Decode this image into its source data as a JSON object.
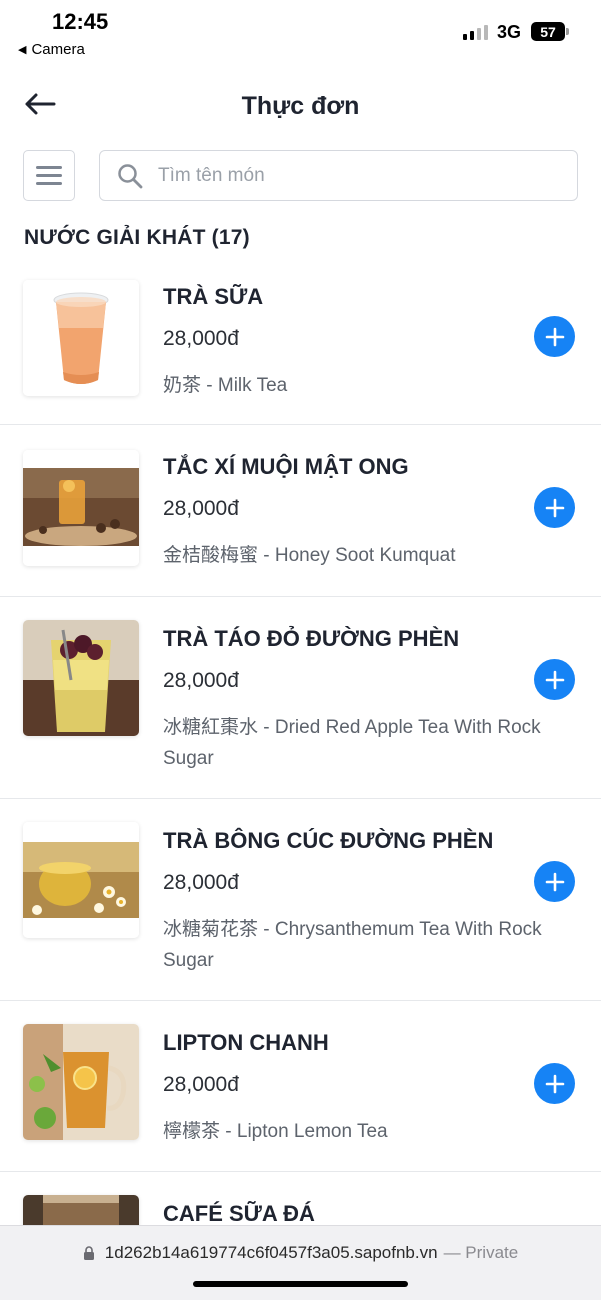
{
  "status_bar": {
    "time": "12:45",
    "back_app": "Camera",
    "network": "3G",
    "battery": "57"
  },
  "header": {
    "title": "Thực đơn"
  },
  "search": {
    "placeholder": "Tìm tên món"
  },
  "category": {
    "label": "NƯỚC GIẢI KHÁT (17)"
  },
  "items": [
    {
      "name": "TRÀ SỮA",
      "price": "28,000đ",
      "desc": "奶茶 - Milk Tea"
    },
    {
      "name": "TẮC XÍ MUỘI MẬT ONG",
      "price": "28,000đ",
      "desc": "金桔酸梅蜜 - Honey Soot Kumquat"
    },
    {
      "name": "TRÀ TÁO ĐỎ ĐƯỜNG PHÈN",
      "price": "28,000đ",
      "desc": "冰糖紅棗水 - Dried Red Apple Tea With Rock Sugar"
    },
    {
      "name": "TRÀ BÔNG CÚC ĐƯỜNG PHÈN",
      "price": "28,000đ",
      "desc": "冰糖菊花茶 - Chrysanthemum Tea With Rock Sugar"
    },
    {
      "name": "LIPTON CHANH",
      "price": "28,000đ",
      "desc": "檸檬茶 - Lipton Lemon Tea"
    },
    {
      "name": "CAFÉ SỮA ĐÁ",
      "price": "",
      "desc": ""
    }
  ],
  "url_bar": {
    "url": "1d262b14a619774c6f0457f3a05.sapofnb.vn",
    "suffix": "— Private"
  },
  "colors": {
    "accent": "#1683f5",
    "text_primary": "#1f2430",
    "divider": "#e6e8eb"
  }
}
